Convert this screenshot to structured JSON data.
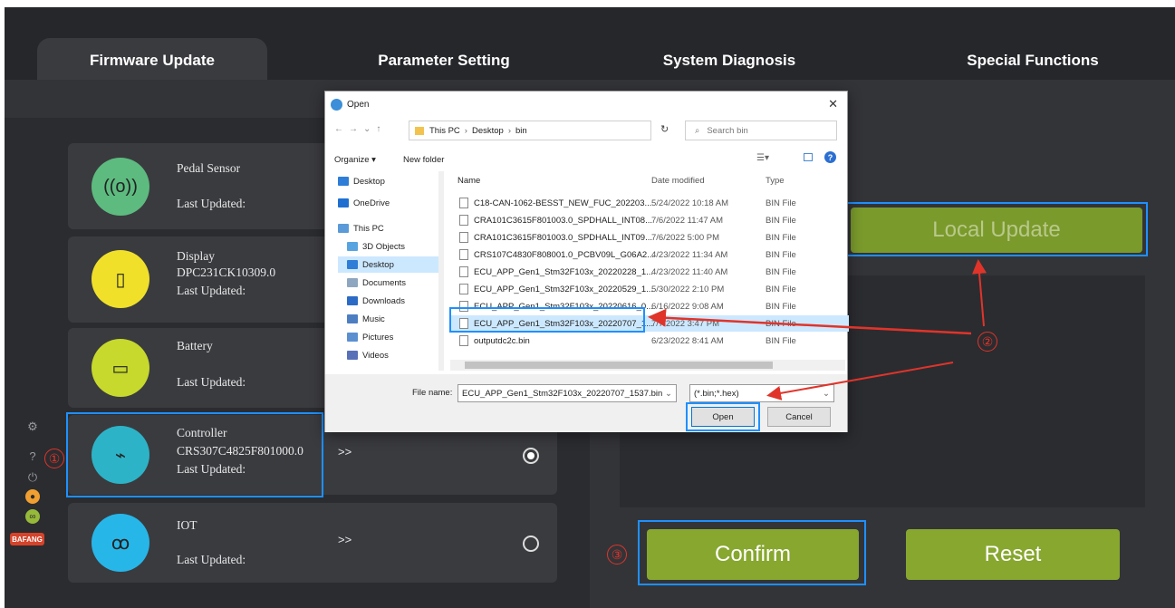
{
  "tabs": [
    {
      "label": "Firmware Update",
      "active": true
    },
    {
      "label": "Parameter Setting",
      "active": false
    },
    {
      "label": "System Diagnosis",
      "active": false
    },
    {
      "label": "Special Functions",
      "active": false
    }
  ],
  "components": [
    {
      "title": "Pedal Sensor",
      "model": "",
      "updated": "Last Updated:",
      "color": "#5dbb7f",
      "icon": "sensor-icon",
      "glyph": "((o))",
      "chevron": "",
      "radio": ""
    },
    {
      "title": "Display",
      "model": "DPC231CK10309.0",
      "updated": "Last Updated:",
      "color": "#f0e02a",
      "icon": "display-icon",
      "glyph": "▯",
      "chevron": "",
      "radio": ""
    },
    {
      "title": "Battery",
      "model": "",
      "updated": "Last Updated:",
      "color": "#c6d92c",
      "icon": "battery-icon",
      "glyph": "▭",
      "chevron": "",
      "radio": ""
    },
    {
      "title": "Controller",
      "model": "CRS307C4825F801000.0",
      "updated": "Last Updated:",
      "color": "#2db3c7",
      "icon": "controller-icon",
      "glyph": "⌁",
      "chevron": ">>",
      "radio": "selected"
    },
    {
      "title": "IOT",
      "model": "",
      "updated": "Last Updated:",
      "color": "#27b6e8",
      "icon": "bicycle-icon",
      "glyph": "ꝏ",
      "chevron": ">>",
      "radio": "unselected"
    }
  ],
  "actions": {
    "local_update": "Local Update",
    "confirm": "Confirm",
    "reset": "Reset"
  },
  "callouts": {
    "one": "①",
    "two": "②",
    "three": "③"
  },
  "logo": "BAFANG",
  "dialog": {
    "title": "Open",
    "close": "✕",
    "breadcrumb": [
      "This PC",
      "Desktop",
      "bin"
    ],
    "search_placeholder": "Search bin",
    "organize": "Organize ▾",
    "new_folder": "New folder",
    "columns": {
      "name": "Name",
      "date": "Date modified",
      "type": "Type"
    },
    "nav": [
      {
        "label": "Desktop",
        "color": "#2e7dd7"
      },
      {
        "label": "OneDrive",
        "color": "#1f6fd1"
      },
      {
        "label": "This PC",
        "color": "#5a9ad8"
      },
      {
        "label": "3D Objects",
        "color": "#58a4e0"
      },
      {
        "label": "Desktop",
        "color": "#2e7dd7"
      },
      {
        "label": "Documents",
        "color": "#8ea6c0"
      },
      {
        "label": "Downloads",
        "color": "#2c6bc5"
      },
      {
        "label": "Music",
        "color": "#4d7ec2"
      },
      {
        "label": "Pictures",
        "color": "#5c8fd0"
      },
      {
        "label": "Videos",
        "color": "#5870b8"
      }
    ],
    "files": [
      {
        "name": "C18-CAN-1062-BESST_NEW_FUC_202203...",
        "date": "5/24/2022 10:18 AM",
        "type": "BIN File"
      },
      {
        "name": "CRA101C3615F801003.0_SPDHALL_INT08...",
        "date": "7/6/2022 11:47 AM",
        "type": "BIN File"
      },
      {
        "name": "CRA101C3615F801003.0_SPDHALL_INT09...",
        "date": "7/6/2022 5:00 PM",
        "type": "BIN File"
      },
      {
        "name": "CRS107C4830F808001.0_PCBV09L_G06A2...",
        "date": "4/23/2022 11:34 AM",
        "type": "BIN File"
      },
      {
        "name": "ECU_APP_Gen1_Stm32F103x_20220228_1...",
        "date": "4/23/2022 11:40 AM",
        "type": "BIN File"
      },
      {
        "name": "ECU_APP_Gen1_Stm32F103x_20220529_1...",
        "date": "5/30/2022 2:10 PM",
        "type": "BIN File"
      },
      {
        "name": "ECU_APP_Gen1_Stm32F103x_20220616_0...",
        "date": "6/16/2022 9:08 AM",
        "type": "BIN File"
      },
      {
        "name": "ECU_APP_Gen1_Stm32F103x_20220707_1...",
        "date": "7/7/2022 3:47 PM",
        "type": "BIN File",
        "selected": true
      },
      {
        "name": "outputdc2c.bin",
        "date": "6/23/2022 8:41 AM",
        "type": "BIN File"
      }
    ],
    "file_name_label": "File name:",
    "file_name_value": "ECU_APP_Gen1_Stm32F103x_20220707_1537.bin",
    "filter": "(*.bin;*.hex)",
    "open": "Open",
    "cancel": "Cancel"
  }
}
